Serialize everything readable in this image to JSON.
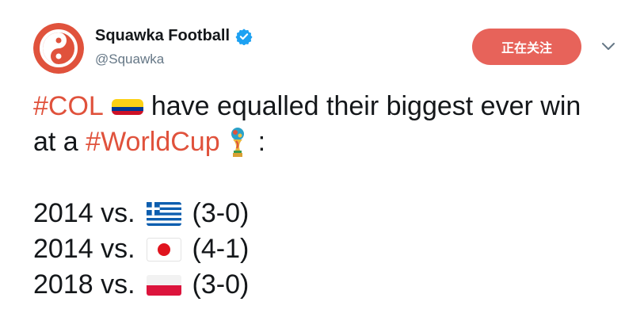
{
  "author": {
    "name": "Squawka Football",
    "handle": "@Squawka",
    "verified_icon": "verified-badge-icon",
    "avatar_icon": "squawka-logo"
  },
  "actions": {
    "follow_label": "正在关注",
    "menu_icon": "chevron-down-icon"
  },
  "tweet": {
    "line1": {
      "hashtag": "#COL",
      "flag": "colombia-flag-icon",
      "text": "have equalled their biggest ever win"
    },
    "line2": {
      "prefix": "at a ",
      "hashtag": "#WorldCup",
      "emoji": "world-cup-trophy-icon",
      "suffix": ":"
    },
    "results": [
      {
        "year_vs": "2014 vs.",
        "flag": "greece-flag-icon",
        "score": "(3-0)"
      },
      {
        "year_vs": "2014 vs.",
        "flag": "japan-flag-icon",
        "score": "(4-1)"
      },
      {
        "year_vs": "2018 vs.",
        "flag": "poland-flag-icon",
        "score": "(3-0)"
      }
    ]
  },
  "colors": {
    "accent": "#e0523c",
    "follow_button": "#e7635a",
    "handle": "#657786",
    "verified": "#1da1f2"
  }
}
